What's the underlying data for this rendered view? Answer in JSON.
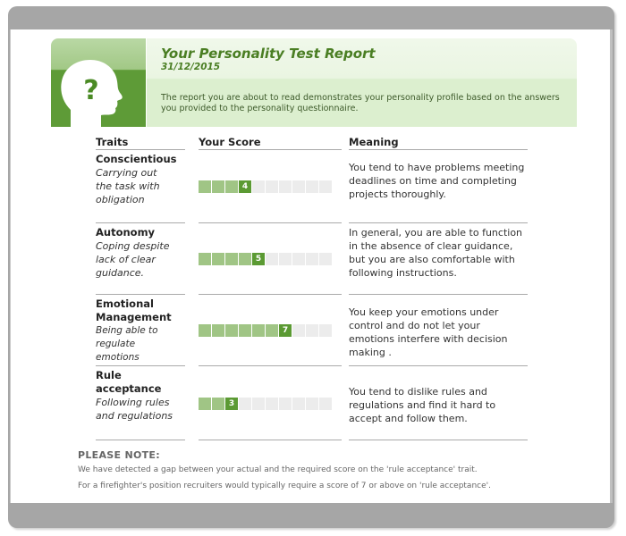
{
  "report": {
    "title": "Your Personality Test Report",
    "date": "31/12/2015",
    "intro": "The report you are about to read demonstrates your personality profile based on the answers you provided to the personality questionnaire.",
    "icon": "head-question-icon"
  },
  "table": {
    "headers": [
      "Traits",
      "Your Score",
      "Meaning"
    ],
    "score_max": 10,
    "rows": [
      {
        "name": "Conscientious",
        "description": "Carrying out the task with obligation",
        "score": 4,
        "score_label": "4",
        "meaning": "You tend to have problems meeting deadlines on time and completing projects thoroughly."
      },
      {
        "name": "Autonomy",
        "description": "Coping despite lack of clear guidance.",
        "score": 5,
        "score_label": "5",
        "meaning": "In general, you are able to function in the absence of clear guidance, but you are also comfortable with following instructions."
      },
      {
        "name": "Emotional Management",
        "description": "Being able to regulate emotions",
        "score": 7,
        "score_label": "7",
        "meaning": "You keep your emotions under control and do not let your emotions interfere with decision making ."
      },
      {
        "name": "Rule acceptance",
        "description": "Following rules and regulations",
        "score": 3,
        "score_label": "3",
        "meaning": "You tend to dislike rules and regulations and find it hard to accept and follow them."
      }
    ]
  },
  "note": {
    "title": "PLEASE NOTE:",
    "lines": [
      "We have detected a gap between your actual and the required score on the 'rule acceptance' trait.",
      "For a firefighter's position recruiters would typically require a score of 7 or above on 'rule acceptance'."
    ]
  },
  "colors": {
    "accent_dark": "#5b9a33",
    "accent_light": "#a0c585",
    "empty_cell": "#ececec",
    "title_green": "#4a7e23",
    "frame_gray": "#a6a6a6"
  }
}
